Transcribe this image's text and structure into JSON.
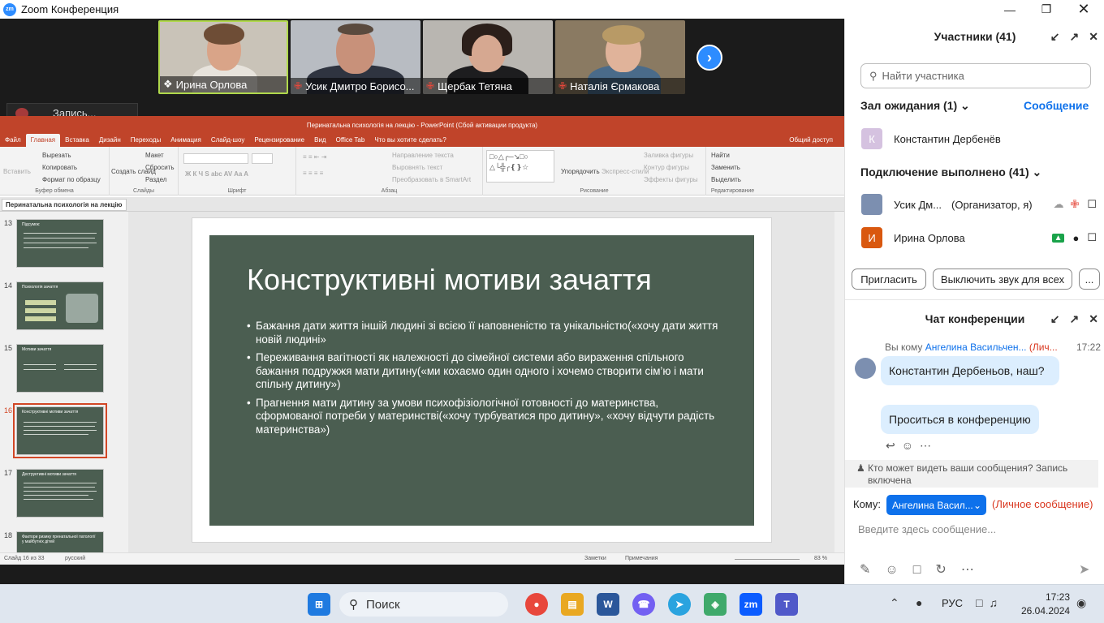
{
  "window": {
    "title": "Zoom Конференция",
    "logo": "zm"
  },
  "videos": [
    {
      "name": "Ирина Орлова"
    },
    {
      "name": "Усик Дмитро Борисо..."
    },
    {
      "name": "Щербак Тетяна"
    },
    {
      "name": "Наталія  Єрмакова"
    }
  ],
  "recording": {
    "label": "Запись..."
  },
  "ppt": {
    "title": "Перинатальна психологія на лекцію - PowerPoint (Сбой активации продукта)",
    "tabs": [
      "Файл",
      "Главная",
      "Вставка",
      "Дизайн",
      "Переходы",
      "Анимация",
      "Слайд-шоу",
      "Рецензирование",
      "Вид",
      "Office Tab",
      "Что вы хотите сделать?"
    ],
    "share": "Общий доступ",
    "ribbon": {
      "paste": "Вставить",
      "cut": "Вырезать",
      "copy": "Копировать",
      "format_painter": "Формат по образцу",
      "clipboard": "Буфер обмена",
      "new_slide": "Создать слайд",
      "layout": "Макет",
      "reset": "Сбросить",
      "section": "Раздел",
      "slides": "Слайды",
      "font": "Шрифт",
      "paragraph": "Абзац",
      "text_direction": "Направление текста",
      "align_text": "Выровнять текст",
      "smartart": "Преобразовать в SmartArt",
      "arrange": "Упорядочить",
      "quick_styles": "Экспресс-стили",
      "shape_fill": "Заливка фигуры",
      "shape_outline": "Контур фигуры",
      "shape_effects": "Эффекты фигуры",
      "drawing": "Рисование",
      "find": "Найти",
      "replace": "Заменить",
      "select": "Выделить",
      "editing": "Редактирование"
    },
    "doc_tab": "Перинатальна психологія на лекцію",
    "thumbs": [
      {
        "num": "13",
        "title": "Підсумок:"
      },
      {
        "num": "14",
        "title": "Психологія зачаття"
      },
      {
        "num": "15",
        "title": "Мотиви зачаття"
      },
      {
        "num": "16",
        "title": "Конструктивні мотиви зачаття"
      },
      {
        "num": "17",
        "title": "Деструктивні мотиви зачаття"
      },
      {
        "num": "18",
        "title": "Фактори ризику пренатальної патології у майбутніх дітей"
      }
    ],
    "slide": {
      "title": "Конструктивні мотиви зачаття",
      "bullets": [
        "Бажання дати життя іншій людині зі всією її наповненістю та унікальністю(«хочу дати життя новій людині»",
        "Переживання вагітності як належності до сімейної системи або вираження спільного бажання подружжя мати дитину(«ми кохаємо один одного і хочемо створити сім’ю і мати спільну дитину»)",
        "Прагнення мати дитину за умови психофізіологічної готовності до материнства, сформованої потреби у материнстві(«хочу турбуватися про дитину», «хочу відчути радість материнства»)"
      ]
    },
    "status": {
      "slide": "Слайд 16 из 33",
      "lang": "русский",
      "notes": "Заметки",
      "comments": "Примечания",
      "zoom": "83 %"
    }
  },
  "participants": {
    "title": "Участники (41)",
    "search_placeholder": "Найти участника",
    "waiting": "Зал ожидания (1)",
    "message_link": "Сообщение",
    "waiting_person": {
      "initial": "К",
      "name": "Константин Дербенёв"
    },
    "connected": "Подключение выполнено (41)",
    "people": [
      {
        "name": "Усик Дм...",
        "role": "(Организатор, я)"
      },
      {
        "initial": "И",
        "name": "Ирина Орлова"
      }
    ],
    "invite": "Пригласить",
    "mute_all": "Выключить звук для всех",
    "more": "..."
  },
  "chat": {
    "title": "Чат конференции",
    "meta_prefix": "Вы кому",
    "meta_to": "Ангелина Васильчен...",
    "meta_private": "(Лич...",
    "meta_time": "17:22",
    "messages": [
      "Константин Дербеньов, наш?",
      "Проситься в конференцию"
    ],
    "who_can_see": "Кто может видеть ваши сообщения? Запись включена",
    "to_label": "Кому:",
    "recipient": "Ангелина Васил...",
    "private_note": "(Личное сообщение)",
    "input_placeholder": "Введите здесь сообщение..."
  },
  "taskbar": {
    "search": "Поиск",
    "lang": "РУС",
    "time": "17:23",
    "date": "26.04.2024"
  }
}
